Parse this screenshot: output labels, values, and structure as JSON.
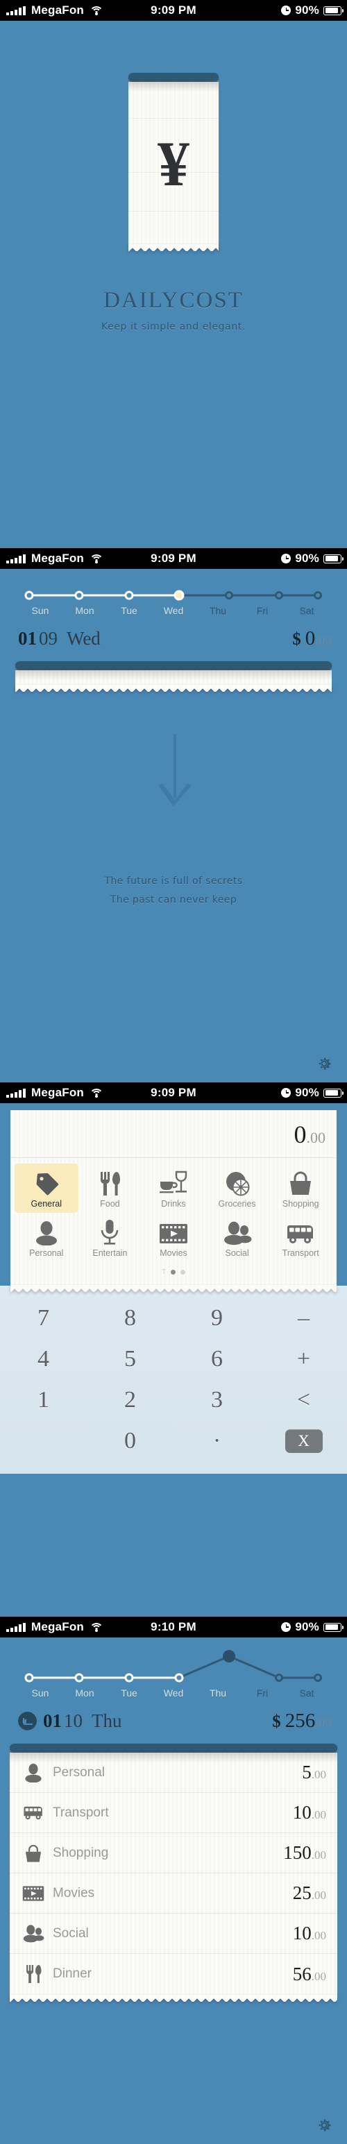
{
  "statusbar_1": {
    "carrier": "MegaFon",
    "time": "9:09 PM",
    "battery": "90%"
  },
  "statusbar_2": {
    "carrier": "MegaFon",
    "time": "9:09 PM",
    "battery": "90%"
  },
  "statusbar_3": {
    "carrier": "MegaFon",
    "time": "9:09 PM",
    "battery": "90%"
  },
  "statusbar_4": {
    "carrier": "MegaFon",
    "time": "9:10 PM",
    "battery": "90%"
  },
  "splash": {
    "currency_glyph": "¥",
    "title": "DAILYCOST",
    "tagline": "Keep it simple and elegant."
  },
  "theme": {
    "background": "#4b89b5",
    "paper": "#fbfbf8",
    "accent_yellow": "#fbecbe",
    "dark_blue": "#2f5873",
    "keypad_bg": "#dde9f0"
  },
  "screen2": {
    "week_days": [
      "Sun",
      "Mon",
      "Tue",
      "Wed",
      "Thu",
      "Fri",
      "Sat"
    ],
    "selected_day": "Wed",
    "date": {
      "month": "01",
      "day": "09",
      "weekday": "Wed"
    },
    "total": {
      "currency": "$",
      "integer": "0",
      "decimal": ".00"
    },
    "quote_line_1": "The future is full of secrets",
    "quote_line_2": "The past can never keep",
    "settings_icon": "gear-icon",
    "arrow_icon": "arrow-down-icon"
  },
  "screen3": {
    "amount": {
      "integer": "0",
      "decimal": ".00"
    },
    "categories": [
      {
        "label": "General",
        "icon": "tag-icon",
        "selected": true
      },
      {
        "label": "Food",
        "icon": "cutlery-icon",
        "selected": false
      },
      {
        "label": "Drinks",
        "icon": "drinks-icon",
        "selected": false
      },
      {
        "label": "Groceries",
        "icon": "lemon-icon",
        "selected": false
      },
      {
        "label": "Shopping",
        "icon": "basket-icon",
        "selected": false
      },
      {
        "label": "Personal",
        "icon": "person-icon",
        "selected": false
      },
      {
        "label": "Entertain",
        "icon": "microphone-icon",
        "selected": false
      },
      {
        "label": "Movies",
        "icon": "film-icon",
        "selected": false
      },
      {
        "label": "Social",
        "icon": "people-icon",
        "selected": false
      },
      {
        "label": "Transport",
        "icon": "bus-icon",
        "selected": false
      }
    ],
    "pager": {
      "prefix": "T",
      "dots": 2,
      "active_index": 0
    },
    "keypad": [
      [
        "7",
        "8",
        "9",
        "–"
      ],
      [
        "4",
        "5",
        "6",
        "+"
      ],
      [
        "1",
        "2",
        "3",
        "<"
      ],
      [
        "",
        "0",
        "·",
        "X"
      ]
    ]
  },
  "screen4": {
    "week_days": [
      "Sun",
      "Mon",
      "Tue",
      "Wed",
      "Thu",
      "Fri",
      "Sat"
    ],
    "selected_day": "Thu",
    "back_icon": "back-arrow-icon",
    "date": {
      "month": "01",
      "day": "10",
      "weekday": "Thu"
    },
    "total": {
      "currency": "$",
      "integer": "256",
      "decimal": ".00"
    },
    "entries": [
      {
        "label": "Personal",
        "icon": "person-icon",
        "integer": "5",
        "decimal": ".00"
      },
      {
        "label": "Transport",
        "icon": "bus-icon",
        "integer": "10",
        "decimal": ".00"
      },
      {
        "label": "Shopping",
        "icon": "basket-icon",
        "integer": "150",
        "decimal": ".00"
      },
      {
        "label": "Movies",
        "icon": "film-icon",
        "integer": "25",
        "decimal": ".00"
      },
      {
        "label": "Social",
        "icon": "people-icon",
        "integer": "10",
        "decimal": ".00"
      },
      {
        "label": "Dinner",
        "icon": "cutlery-icon",
        "integer": "56",
        "decimal": ".00"
      }
    ],
    "settings_icon": "gear-icon"
  },
  "chart_data": [
    {
      "type": "line",
      "title": "",
      "categories": [
        "Sun",
        "Mon",
        "Tue",
        "Wed",
        "Thu",
        "Fri",
        "Sat"
      ],
      "values": [
        0,
        0,
        0,
        0,
        0,
        0,
        0
      ],
      "highlight_index": 3,
      "xlabel": "",
      "ylabel": "",
      "ylim": [
        0,
        1
      ],
      "legend": "none",
      "grid": false
    },
    {
      "type": "line",
      "title": "",
      "categories": [
        "Sun",
        "Mon",
        "Tue",
        "Wed",
        "Thu",
        "Fri",
        "Sat"
      ],
      "values": [
        0,
        0,
        0,
        0,
        256,
        0,
        0
      ],
      "highlight_index": 4,
      "xlabel": "",
      "ylabel": "",
      "ylim": [
        0,
        280
      ],
      "legend": "none",
      "grid": false
    }
  ]
}
